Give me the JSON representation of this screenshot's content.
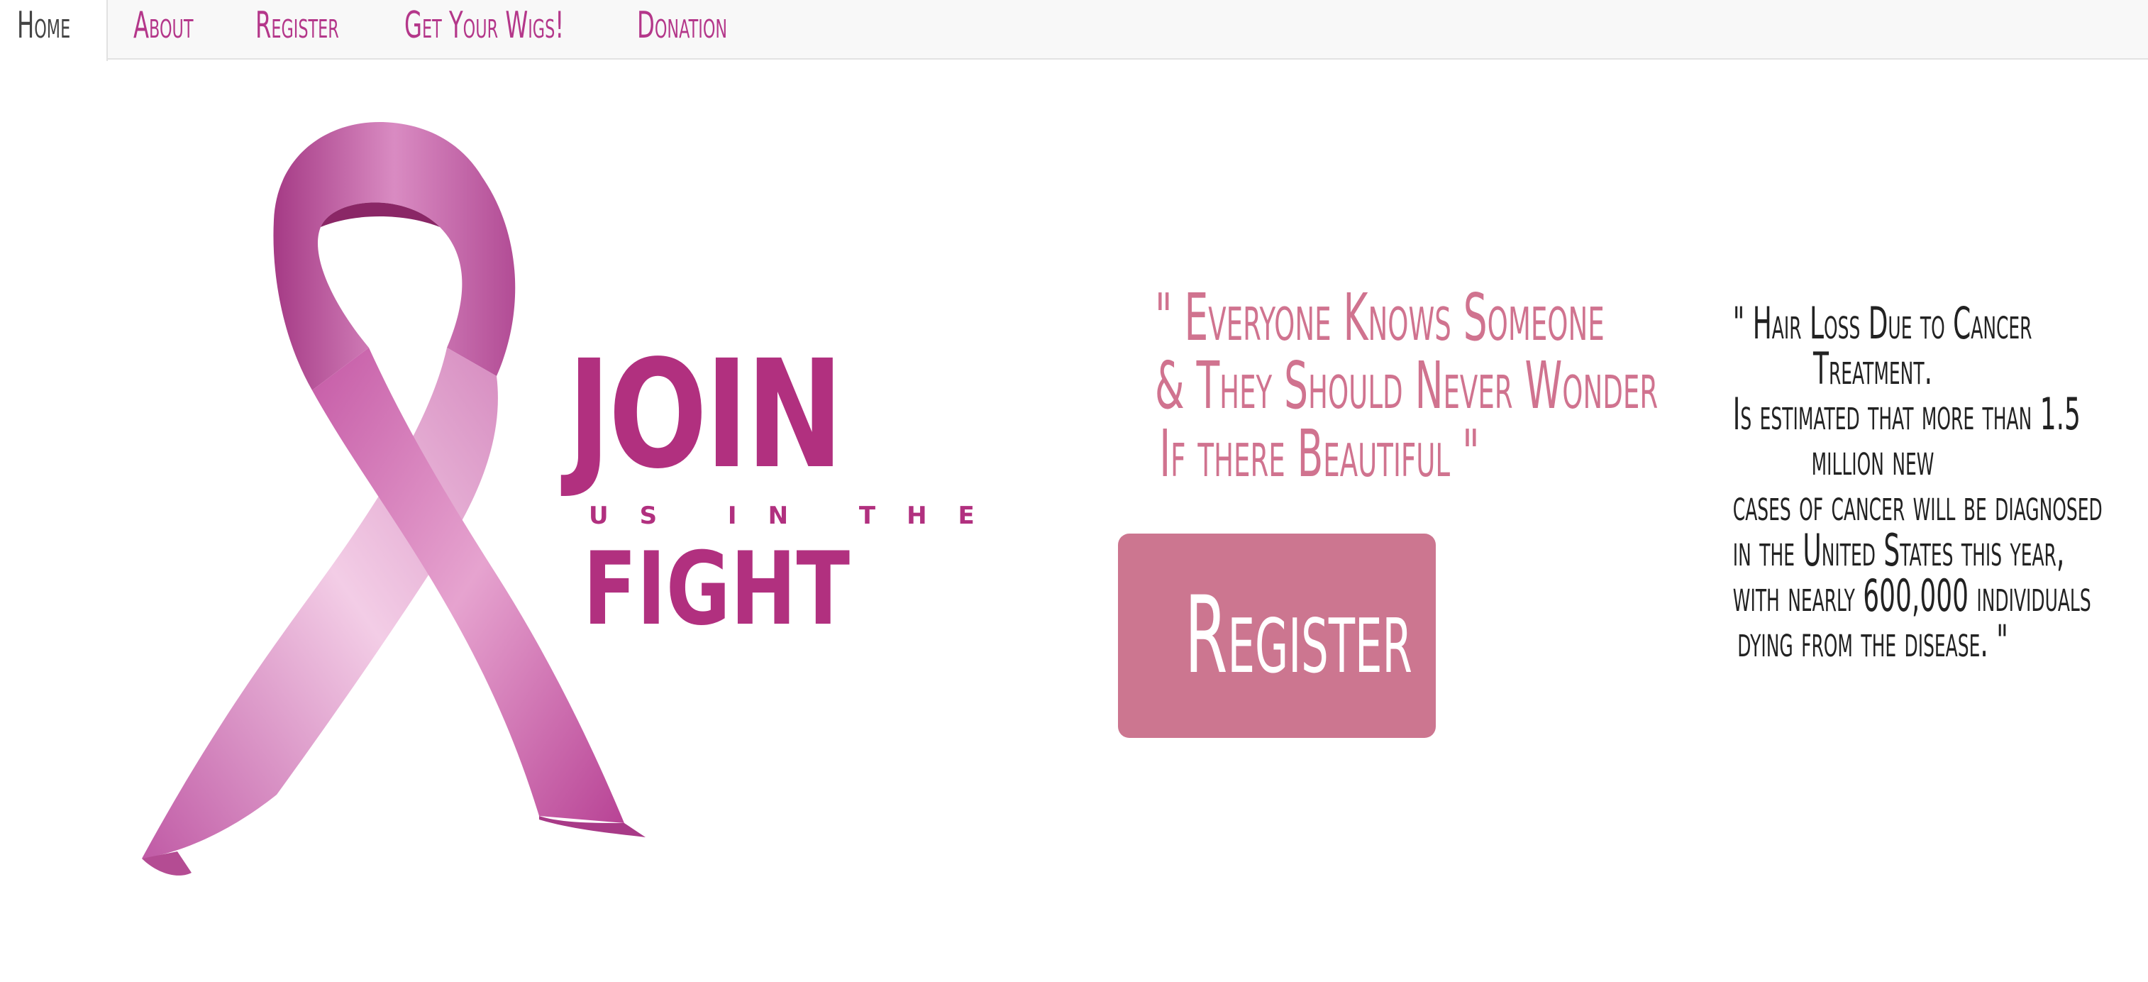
{
  "nav": {
    "items": [
      {
        "label": "Home",
        "active": true
      },
      {
        "label": "About",
        "active": false
      },
      {
        "label": "Register",
        "active": false
      },
      {
        "label": "Get Your Wigs!",
        "active": false
      },
      {
        "label": "Donation",
        "active": false
      }
    ]
  },
  "hero": {
    "join": "JOIN",
    "us_in_the": "US IN THE",
    "fight": "FIGHT",
    "ribbon_icon": "pink-ribbon-icon",
    "brand_color": "#b1307f"
  },
  "quote_center": {
    "lines": [
      "\" Everyone Knows Someone",
      "& They Should Never Wonder",
      "If there Beautiful \""
    ],
    "color": "#d0738f"
  },
  "register_button": {
    "label": "Register",
    "color": "#cc7690"
  },
  "quote_right": {
    "lines": [
      "\" Hair Loss Due to Cancer",
      "Treatment.",
      "Is estimated that more than 1.5",
      "million new",
      "cases of cancer will be diagnosed",
      "in the United States this year,",
      "with nearly 600,000 individuals",
      "dying from the disease. \""
    ]
  }
}
